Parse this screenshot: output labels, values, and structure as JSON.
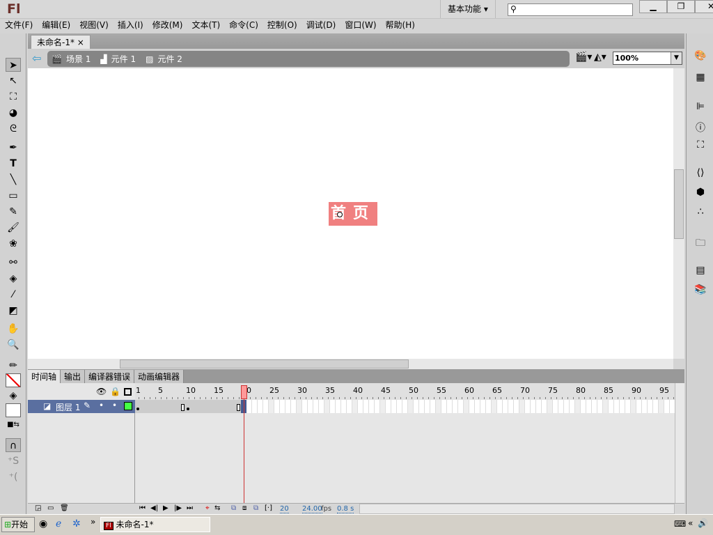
{
  "app": {
    "logo": "Fl",
    "workspace": "基本功能",
    "search_placeholder": ""
  },
  "window_buttons": {
    "minimize": "▁",
    "restore": "❐",
    "close": "✕"
  },
  "menu": [
    "文件(F)",
    "编辑(E)",
    "视图(V)",
    "插入(I)",
    "修改(M)",
    "文本(T)",
    "命令(C)",
    "控制(O)",
    "调试(D)",
    "窗口(W)",
    "帮助(H)"
  ],
  "document": {
    "tab": "未命名-1*",
    "close": "×"
  },
  "breadcrumb": [
    {
      "label": "场景 1",
      "icon": "scene-icon"
    },
    {
      "label": "元件 1",
      "icon": "movieclip-icon"
    },
    {
      "label": "元件 2",
      "icon": "graphic-icon"
    }
  ],
  "zoom": "100%",
  "stage": {
    "symbol_text": "首页"
  },
  "timeline": {
    "tabs": [
      "时间轴",
      "输出",
      "编译器错误",
      "动画编辑器"
    ],
    "ruler": [
      "1",
      "5",
      "10",
      "15",
      "20",
      "25",
      "30",
      "35",
      "40",
      "45",
      "50",
      "55",
      "60",
      "65",
      "70",
      "75",
      "80",
      "85",
      "90",
      "95"
    ],
    "layer": "图层 1",
    "current_frame": "20",
    "fps": "24.00",
    "fps_unit": "fps",
    "time": "0.8 s"
  },
  "taskbar": {
    "start": "开始",
    "task": "未命名-1*"
  }
}
